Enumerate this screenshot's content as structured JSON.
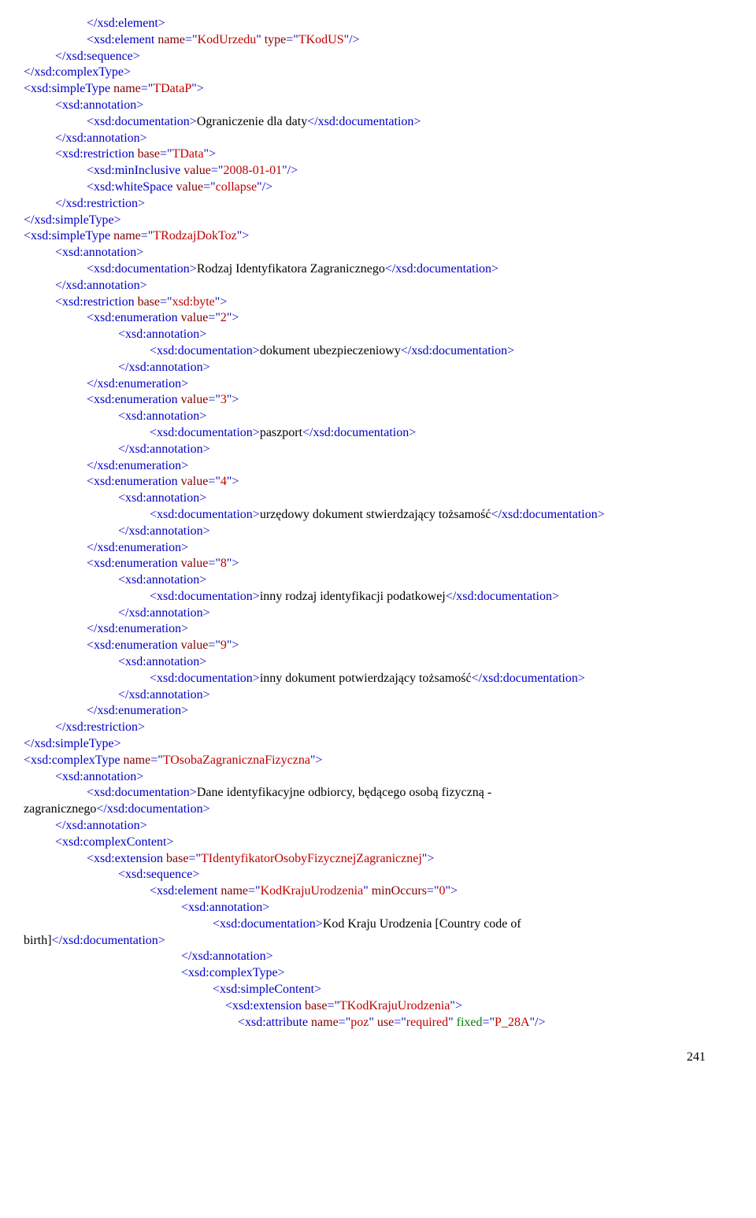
{
  "lines": [
    {
      "indent": "i2",
      "parts": [
        {
          "cls": "blue",
          "t": "</xsd:element>"
        }
      ]
    },
    {
      "indent": "i2",
      "parts": [
        {
          "cls": "blue",
          "t": "<xsd:element"
        },
        {
          "cls": "darkred",
          "t": " name"
        },
        {
          "cls": "blue",
          "t": "=\""
        },
        {
          "cls": "red",
          "t": "KodUrzedu"
        },
        {
          "cls": "blue",
          "t": "\""
        },
        {
          "cls": "darkred",
          "t": " type"
        },
        {
          "cls": "blue",
          "t": "=\""
        },
        {
          "cls": "red",
          "t": "TKodUS"
        },
        {
          "cls": "blue",
          "t": "\"/>"
        }
      ]
    },
    {
      "indent": "i1",
      "parts": [
        {
          "cls": "blue",
          "t": "</xsd:sequence>"
        }
      ]
    },
    {
      "indent": "i0",
      "parts": [
        {
          "cls": "blue",
          "t": "</xsd:complexType>"
        }
      ]
    },
    {
      "indent": "i0",
      "parts": [
        {
          "cls": "blue",
          "t": "<xsd:simpleType"
        },
        {
          "cls": "darkred",
          "t": " name"
        },
        {
          "cls": "blue",
          "t": "=\""
        },
        {
          "cls": "red",
          "t": "TDataP"
        },
        {
          "cls": "blue",
          "t": "\">"
        }
      ]
    },
    {
      "indent": "i1",
      "parts": [
        {
          "cls": "blue",
          "t": "<xsd:annotation>"
        }
      ]
    },
    {
      "indent": "i2",
      "parts": [
        {
          "cls": "blue",
          "t": "<xsd:documentation>"
        },
        {
          "cls": "black",
          "t": "Ograniczenie dla daty"
        },
        {
          "cls": "blue",
          "t": "</xsd:documentation>"
        }
      ]
    },
    {
      "indent": "i1",
      "parts": [
        {
          "cls": "blue",
          "t": "</xsd:annotation>"
        }
      ]
    },
    {
      "indent": "i1",
      "parts": [
        {
          "cls": "blue",
          "t": "<xsd:restriction"
        },
        {
          "cls": "darkred",
          "t": " base"
        },
        {
          "cls": "blue",
          "t": "=\""
        },
        {
          "cls": "red",
          "t": "TData"
        },
        {
          "cls": "blue",
          "t": "\">"
        }
      ]
    },
    {
      "indent": "i2",
      "parts": [
        {
          "cls": "blue",
          "t": "<xsd:minInclusive"
        },
        {
          "cls": "darkred",
          "t": " value"
        },
        {
          "cls": "blue",
          "t": "=\""
        },
        {
          "cls": "red",
          "t": "2008-01-01"
        },
        {
          "cls": "blue",
          "t": "\"/>"
        }
      ]
    },
    {
      "indent": "i2",
      "parts": [
        {
          "cls": "blue",
          "t": "<xsd:whiteSpace"
        },
        {
          "cls": "darkred",
          "t": " value"
        },
        {
          "cls": "blue",
          "t": "=\""
        },
        {
          "cls": "red",
          "t": "collapse"
        },
        {
          "cls": "blue",
          "t": "\"/>"
        }
      ]
    },
    {
      "indent": "i1",
      "parts": [
        {
          "cls": "blue",
          "t": "</xsd:restriction>"
        }
      ]
    },
    {
      "indent": "i0",
      "parts": [
        {
          "cls": "blue",
          "t": "</xsd:simpleType>"
        }
      ]
    },
    {
      "indent": "i0",
      "parts": [
        {
          "cls": "blue",
          "t": "<xsd:simpleType"
        },
        {
          "cls": "darkred",
          "t": " name"
        },
        {
          "cls": "blue",
          "t": "=\""
        },
        {
          "cls": "red",
          "t": "TRodzajDokToz"
        },
        {
          "cls": "blue",
          "t": "\">"
        }
      ]
    },
    {
      "indent": "i1",
      "parts": [
        {
          "cls": "blue",
          "t": "<xsd:annotation>"
        }
      ]
    },
    {
      "indent": "i2",
      "parts": [
        {
          "cls": "blue",
          "t": "<xsd:documentation>"
        },
        {
          "cls": "black",
          "t": "Rodzaj Identyfikatora Zagranicznego"
        },
        {
          "cls": "blue",
          "t": "</xsd:documentation>"
        }
      ]
    },
    {
      "indent": "i1",
      "parts": [
        {
          "cls": "blue",
          "t": "</xsd:annotation>"
        }
      ]
    },
    {
      "indent": "i1",
      "parts": [
        {
          "cls": "blue",
          "t": "<xsd:restriction"
        },
        {
          "cls": "darkred",
          "t": " base"
        },
        {
          "cls": "blue",
          "t": "=\""
        },
        {
          "cls": "red",
          "t": "xsd:byte"
        },
        {
          "cls": "blue",
          "t": "\">"
        }
      ]
    },
    {
      "indent": "i2",
      "parts": [
        {
          "cls": "blue",
          "t": "<xsd:enumeration"
        },
        {
          "cls": "darkred",
          "t": " value"
        },
        {
          "cls": "blue",
          "t": "=\""
        },
        {
          "cls": "red",
          "t": "2"
        },
        {
          "cls": "blue",
          "t": "\">"
        }
      ]
    },
    {
      "indent": "i3",
      "parts": [
        {
          "cls": "blue",
          "t": "<xsd:annotation>"
        }
      ]
    },
    {
      "indent": "i4",
      "parts": [
        {
          "cls": "blue",
          "t": "<xsd:documentation>"
        },
        {
          "cls": "black",
          "t": "dokument ubezpieczeniowy"
        },
        {
          "cls": "blue",
          "t": "</xsd:documentation>"
        }
      ]
    },
    {
      "indent": "i3",
      "parts": [
        {
          "cls": "blue",
          "t": "</xsd:annotation>"
        }
      ]
    },
    {
      "indent": "i2",
      "parts": [
        {
          "cls": "blue",
          "t": "</xsd:enumeration>"
        }
      ]
    },
    {
      "indent": "i2",
      "parts": [
        {
          "cls": "blue",
          "t": "<xsd:enumeration"
        },
        {
          "cls": "darkred",
          "t": " value"
        },
        {
          "cls": "blue",
          "t": "=\""
        },
        {
          "cls": "red",
          "t": "3"
        },
        {
          "cls": "blue",
          "t": "\">"
        }
      ]
    },
    {
      "indent": "i3",
      "parts": [
        {
          "cls": "blue",
          "t": "<xsd:annotation>"
        }
      ]
    },
    {
      "indent": "i4",
      "parts": [
        {
          "cls": "blue",
          "t": "<xsd:documentation>"
        },
        {
          "cls": "black",
          "t": "paszport"
        },
        {
          "cls": "blue",
          "t": "</xsd:documentation>"
        }
      ]
    },
    {
      "indent": "i3",
      "parts": [
        {
          "cls": "blue",
          "t": "</xsd:annotation>"
        }
      ]
    },
    {
      "indent": "i2",
      "parts": [
        {
          "cls": "blue",
          "t": "</xsd:enumeration>"
        }
      ]
    },
    {
      "indent": "i2",
      "parts": [
        {
          "cls": "blue",
          "t": "<xsd:enumeration"
        },
        {
          "cls": "darkred",
          "t": " value"
        },
        {
          "cls": "blue",
          "t": "=\""
        },
        {
          "cls": "red",
          "t": "4"
        },
        {
          "cls": "blue",
          "t": "\">"
        }
      ]
    },
    {
      "indent": "i3",
      "parts": [
        {
          "cls": "blue",
          "t": "<xsd:annotation>"
        }
      ]
    },
    {
      "indent": "i4",
      "parts": [
        {
          "cls": "blue",
          "t": "<xsd:documentation>"
        },
        {
          "cls": "black",
          "t": "urzędowy dokument stwierdzający tożsamość"
        },
        {
          "cls": "blue",
          "t": "</xsd:documentation>"
        }
      ]
    },
    {
      "indent": "i3",
      "parts": [
        {
          "cls": "blue",
          "t": "</xsd:annotation>"
        }
      ]
    },
    {
      "indent": "i2",
      "parts": [
        {
          "cls": "blue",
          "t": "</xsd:enumeration>"
        }
      ]
    },
    {
      "indent": "i2",
      "parts": [
        {
          "cls": "blue",
          "t": "<xsd:enumeration"
        },
        {
          "cls": "darkred",
          "t": " value"
        },
        {
          "cls": "blue",
          "t": "=\""
        },
        {
          "cls": "red",
          "t": "8"
        },
        {
          "cls": "blue",
          "t": "\">"
        }
      ]
    },
    {
      "indent": "i3",
      "parts": [
        {
          "cls": "blue",
          "t": "<xsd:annotation>"
        }
      ]
    },
    {
      "indent": "i4",
      "parts": [
        {
          "cls": "blue",
          "t": "<xsd:documentation>"
        },
        {
          "cls": "black",
          "t": "inny rodzaj identyfikacji podatkowej"
        },
        {
          "cls": "blue",
          "t": "</xsd:documentation>"
        }
      ]
    },
    {
      "indent": "i3",
      "parts": [
        {
          "cls": "blue",
          "t": "</xsd:annotation>"
        }
      ]
    },
    {
      "indent": "i2",
      "parts": [
        {
          "cls": "blue",
          "t": "</xsd:enumeration>"
        }
      ]
    },
    {
      "indent": "i2",
      "parts": [
        {
          "cls": "blue",
          "t": "<xsd:enumeration"
        },
        {
          "cls": "darkred",
          "t": " value"
        },
        {
          "cls": "blue",
          "t": "=\""
        },
        {
          "cls": "red",
          "t": "9"
        },
        {
          "cls": "blue",
          "t": "\">"
        }
      ]
    },
    {
      "indent": "i3",
      "parts": [
        {
          "cls": "blue",
          "t": "<xsd:annotation>"
        }
      ]
    },
    {
      "indent": "i4",
      "parts": [
        {
          "cls": "blue",
          "t": "<xsd:documentation>"
        },
        {
          "cls": "black",
          "t": "inny dokument potwierdzający tożsamość"
        },
        {
          "cls": "blue",
          "t": "</xsd:documentation>"
        }
      ]
    },
    {
      "indent": "i3",
      "parts": [
        {
          "cls": "blue",
          "t": "</xsd:annotation>"
        }
      ]
    },
    {
      "indent": "i2",
      "parts": [
        {
          "cls": "blue",
          "t": "</xsd:enumeration>"
        }
      ]
    },
    {
      "indent": "i1",
      "parts": [
        {
          "cls": "blue",
          "t": "</xsd:restriction>"
        }
      ]
    },
    {
      "indent": "i0",
      "parts": [
        {
          "cls": "blue",
          "t": "</xsd:simpleType>"
        }
      ]
    },
    {
      "indent": "i0",
      "parts": [
        {
          "cls": "blue",
          "t": "<xsd:complexType"
        },
        {
          "cls": "darkred",
          "t": " name"
        },
        {
          "cls": "blue",
          "t": "=\""
        },
        {
          "cls": "red",
          "t": "TOsobaZagranicznaFizyczna"
        },
        {
          "cls": "blue",
          "t": "\">"
        }
      ]
    },
    {
      "indent": "i1",
      "parts": [
        {
          "cls": "blue",
          "t": "<xsd:annotation>"
        }
      ]
    },
    {
      "indent": "i2",
      "parts": [
        {
          "cls": "blue",
          "t": "<xsd:documentation>"
        },
        {
          "cls": "black",
          "t": "Dane identyfikacyjne odbiorcy, będącego osobą fizyczną - "
        }
      ]
    },
    {
      "indent": "i0",
      "parts": [
        {
          "cls": "black",
          "t": "zagranicznego"
        },
        {
          "cls": "blue",
          "t": "</xsd:documentation>"
        }
      ]
    },
    {
      "indent": "i1",
      "parts": [
        {
          "cls": "blue",
          "t": "</xsd:annotation>"
        }
      ]
    },
    {
      "indent": "i1",
      "parts": [
        {
          "cls": "blue",
          "t": "<xsd:complexContent>"
        }
      ]
    },
    {
      "indent": "i2",
      "parts": [
        {
          "cls": "blue",
          "t": "<xsd:extension"
        },
        {
          "cls": "darkred",
          "t": " base"
        },
        {
          "cls": "blue",
          "t": "=\""
        },
        {
          "cls": "red",
          "t": "TIdentyfikatorOsobyFizycznejZagranicznej"
        },
        {
          "cls": "blue",
          "t": "\">"
        }
      ]
    },
    {
      "indent": "i3",
      "parts": [
        {
          "cls": "blue",
          "t": "<xsd:sequence>"
        }
      ]
    },
    {
      "indent": "i4",
      "parts": [
        {
          "cls": "blue",
          "t": "<xsd:element"
        },
        {
          "cls": "darkred",
          "t": " name"
        },
        {
          "cls": "blue",
          "t": "=\""
        },
        {
          "cls": "red",
          "t": "KodKrajuUrodzenia"
        },
        {
          "cls": "blue",
          "t": "\""
        },
        {
          "cls": "darkred",
          "t": " minOccurs"
        },
        {
          "cls": "blue",
          "t": "=\""
        },
        {
          "cls": "red",
          "t": "0"
        },
        {
          "cls": "blue",
          "t": "\">"
        }
      ]
    },
    {
      "indent": "i5",
      "parts": [
        {
          "cls": "blue",
          "t": "<xsd:annotation>"
        }
      ]
    },
    {
      "indent": "i6",
      "parts": [
        {
          "cls": "blue",
          "t": "<xsd:documentation>"
        },
        {
          "cls": "black",
          "t": "Kod Kraju Urodzenia [Country code of "
        }
      ]
    },
    {
      "indent": "i0",
      "parts": [
        {
          "cls": "black",
          "t": "birth]"
        },
        {
          "cls": "blue",
          "t": "</xsd:documentation>"
        }
      ]
    },
    {
      "indent": "i5",
      "parts": [
        {
          "cls": "blue",
          "t": "</xsd:annotation>"
        }
      ]
    },
    {
      "indent": "i5",
      "parts": [
        {
          "cls": "blue",
          "t": "<xsd:complexType>"
        }
      ]
    },
    {
      "indent": "i6",
      "parts": [
        {
          "cls": "blue",
          "t": "<xsd:simpleContent>"
        }
      ]
    },
    {
      "indent": "i6",
      "parts": [
        {
          "cls": "blue",
          "t": "    <xsd:extension"
        },
        {
          "cls": "darkred",
          "t": " base"
        },
        {
          "cls": "blue",
          "t": "=\""
        },
        {
          "cls": "red",
          "t": "TKodKrajuUrodzenia"
        },
        {
          "cls": "blue",
          "t": "\">"
        }
      ]
    },
    {
      "indent": "i6",
      "parts": [
        {
          "cls": "blue",
          "t": "        <xsd:attribute"
        },
        {
          "cls": "darkred",
          "t": " name"
        },
        {
          "cls": "blue",
          "t": "=\""
        },
        {
          "cls": "red",
          "t": "poz"
        },
        {
          "cls": "blue",
          "t": "\""
        },
        {
          "cls": "darkred",
          "t": " use"
        },
        {
          "cls": "blue",
          "t": "=\""
        },
        {
          "cls": "red",
          "t": "required"
        },
        {
          "cls": "blue",
          "t": "\""
        },
        {
          "cls": "green",
          "t": " fixed"
        },
        {
          "cls": "blue",
          "t": "=\""
        },
        {
          "cls": "red",
          "t": "P_28A"
        },
        {
          "cls": "blue",
          "t": "\"/>"
        }
      ]
    }
  ],
  "page_number": "241"
}
